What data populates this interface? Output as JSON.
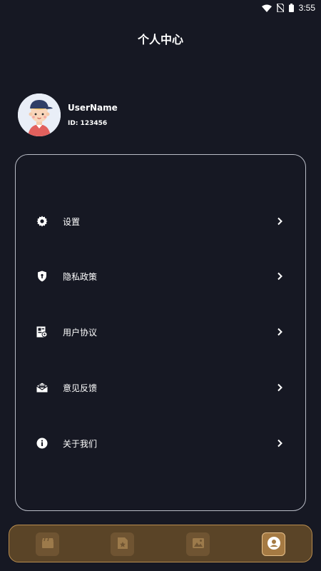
{
  "status_bar": {
    "time": "3:55",
    "icons": [
      "wifi-icon",
      "no-sim-icon",
      "battery-icon"
    ]
  },
  "page": {
    "title": "个人中心"
  },
  "profile": {
    "username": "UserName",
    "user_id": "ID: 123456",
    "avatar_icon": "user-avatar-illustration"
  },
  "menu": {
    "items": [
      {
        "label": "设置",
        "icon": "gear-icon"
      },
      {
        "label": "隐私政策",
        "icon": "shield-icon"
      },
      {
        "label": "用户协议",
        "icon": "agreement-icon"
      },
      {
        "label": "意见反馈",
        "icon": "mail-icon"
      },
      {
        "label": "关于我们",
        "icon": "info-icon"
      }
    ]
  },
  "bottom_nav": {
    "items": [
      {
        "icon": "clapperboard-icon",
        "active": false
      },
      {
        "icon": "star-file-icon",
        "active": false
      },
      {
        "icon": "image-icon",
        "active": false
      },
      {
        "icon": "profile-icon",
        "active": true
      }
    ]
  },
  "colors": {
    "background": "#161823",
    "card_border": "#b9bcc6",
    "nav_background": "#5a4427",
    "nav_border": "#b98d4f",
    "nav_active": "#a57a43"
  }
}
